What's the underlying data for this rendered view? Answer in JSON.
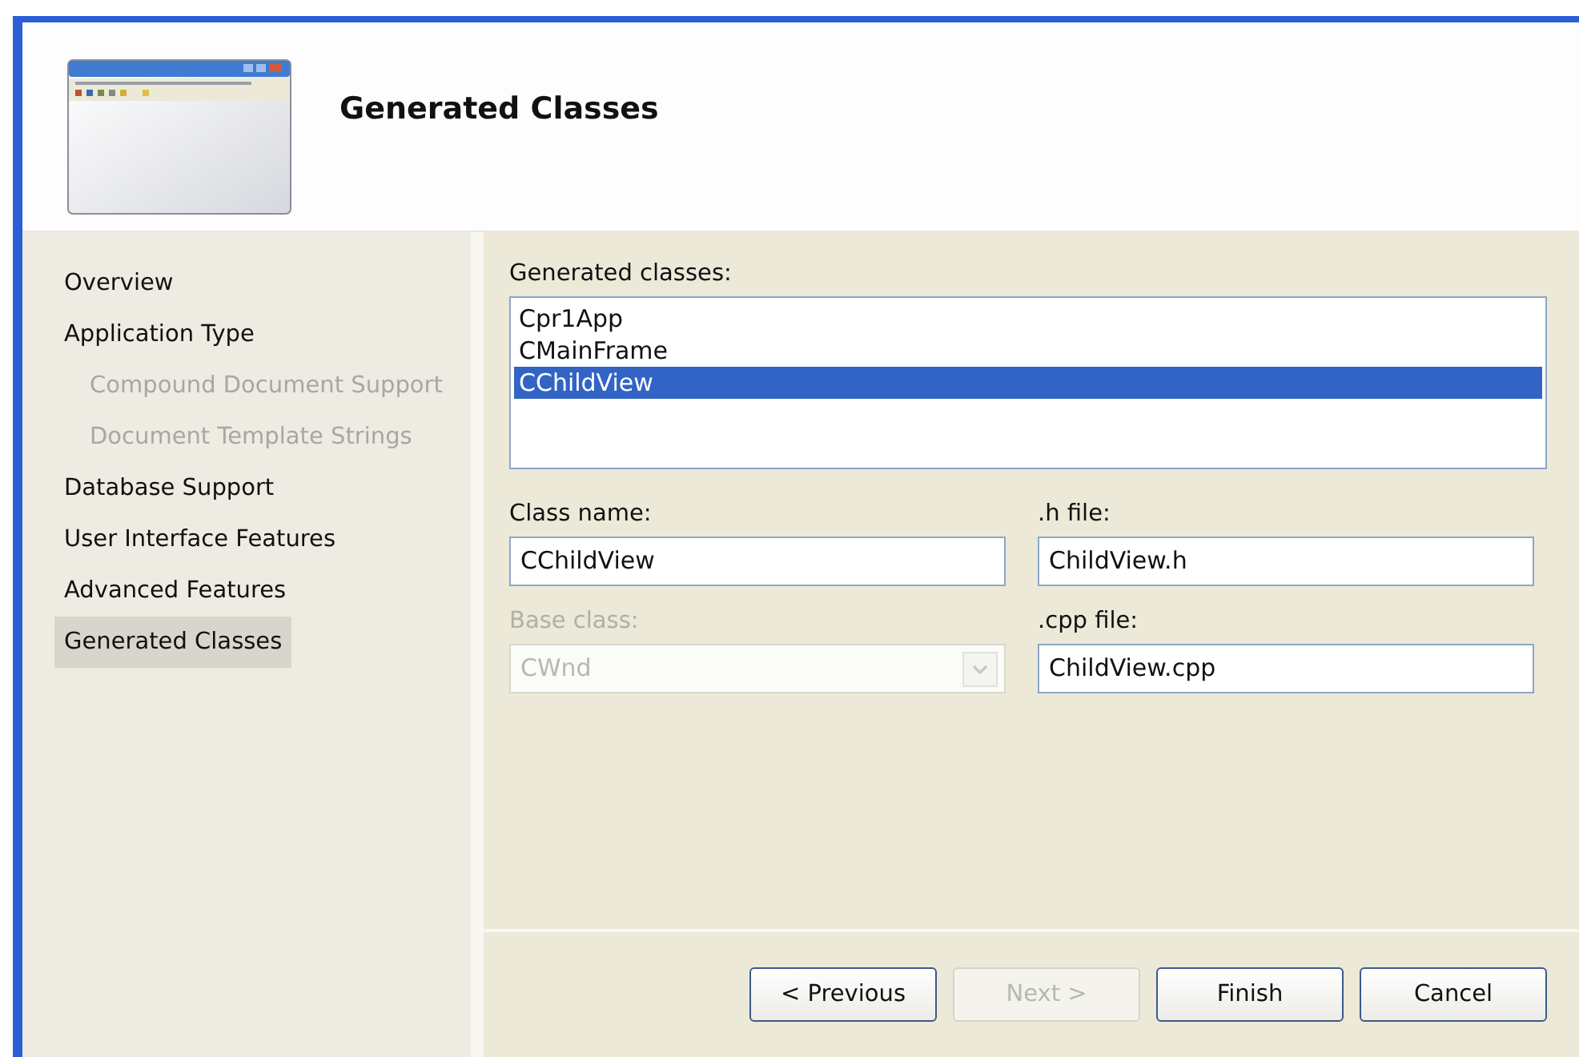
{
  "header": {
    "title": "Generated Classes"
  },
  "sidebar": {
    "items": [
      {
        "label": "Overview",
        "selected": false,
        "disabled": false
      },
      {
        "label": "Application Type",
        "selected": false,
        "disabled": false,
        "children": [
          {
            "label": "Compound Document Support",
            "selected": false,
            "disabled": true
          },
          {
            "label": "Document Template Strings",
            "selected": false,
            "disabled": true
          }
        ]
      },
      {
        "label": "Database Support",
        "selected": false,
        "disabled": false
      },
      {
        "label": "User Interface Features",
        "selected": false,
        "disabled": false
      },
      {
        "label": "Advanced Features",
        "selected": false,
        "disabled": false
      },
      {
        "label": "Generated Classes",
        "selected": true,
        "disabled": false
      }
    ]
  },
  "classes_list": {
    "label": "Generated classes:",
    "items": [
      {
        "label": "Cpr1App",
        "selected": false
      },
      {
        "label": "CMainFrame",
        "selected": false
      },
      {
        "label": "CChildView",
        "selected": true
      }
    ]
  },
  "fields": [
    {
      "kind": "text",
      "label": "Class name:",
      "value": "CChildView",
      "disabled": false
    },
    {
      "kind": "text",
      "label": ".h file:",
      "value": "ChildView.h",
      "disabled": false
    },
    {
      "kind": "dropdown",
      "label": "Base class:",
      "value": "CWnd",
      "disabled": true
    },
    {
      "kind": "text",
      "label": ".cpp file:",
      "value": "ChildView.cpp",
      "disabled": false
    }
  ],
  "buttons": [
    {
      "label": "< Previous",
      "disabled": false
    },
    {
      "label": "Next >",
      "disabled": true
    },
    {
      "label": "Finish",
      "disabled": false
    },
    {
      "label": "Cancel",
      "disabled": false
    }
  ]
}
